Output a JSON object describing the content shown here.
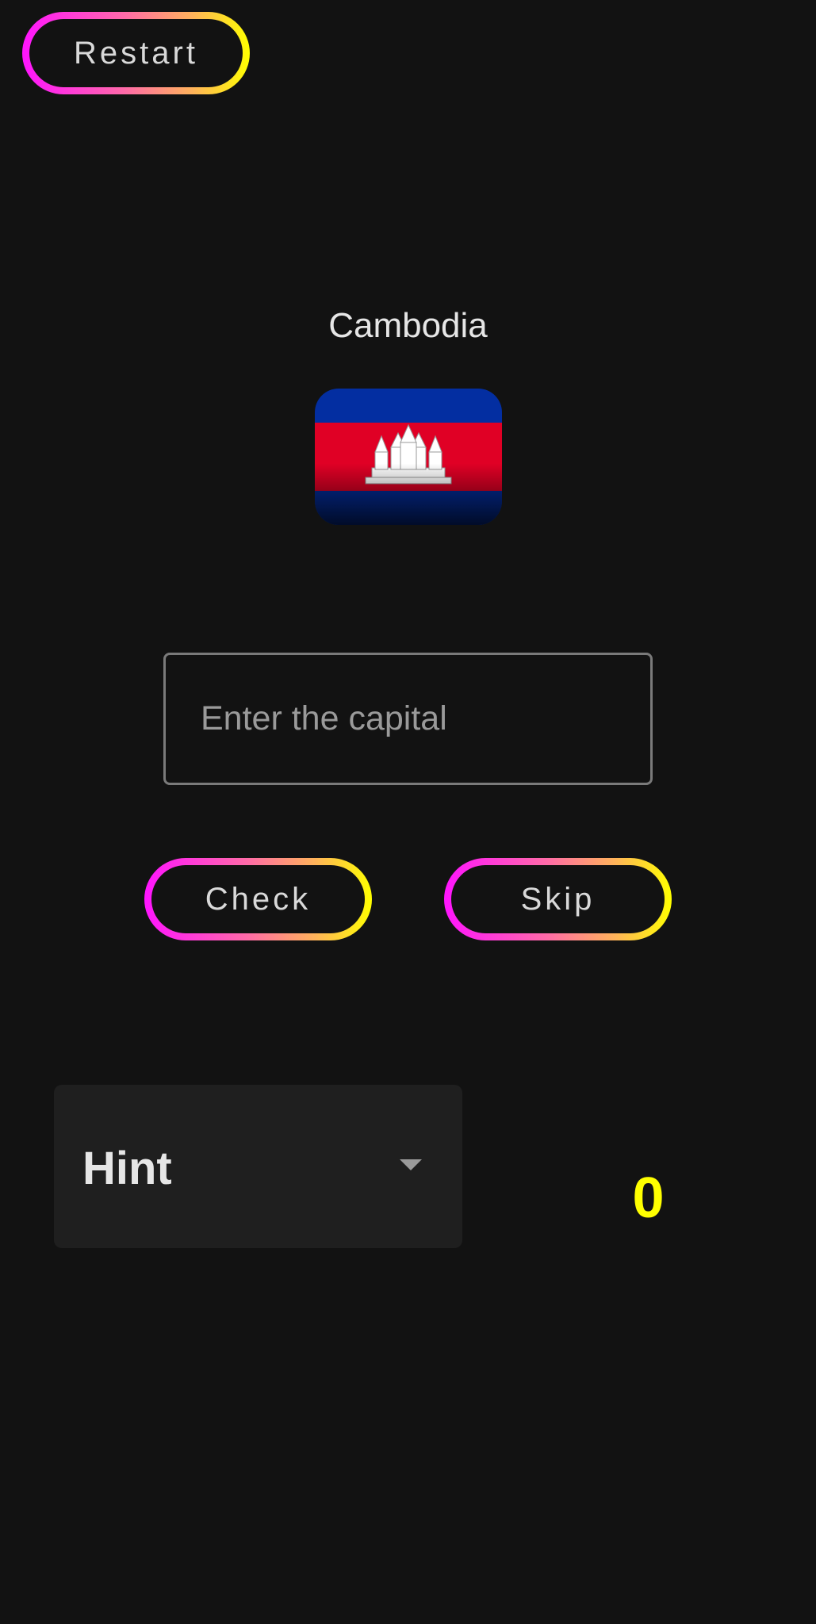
{
  "header": {
    "restart_label": "Restart"
  },
  "question": {
    "country": "Cambodia",
    "flag_icon": "cambodia-flag"
  },
  "answer": {
    "placeholder": "Enter the capital",
    "value": ""
  },
  "actions": {
    "check_label": "Check",
    "skip_label": "Skip"
  },
  "hint": {
    "label": "Hint",
    "icon": "chevron-down-icon"
  },
  "score": {
    "value": "0"
  },
  "colors": {
    "background": "#121212",
    "button_gradient_start": "#ff14ff",
    "button_gradient_end": "#ffff00",
    "score_color": "#ffff00",
    "flag_blue": "#032ea1",
    "flag_red": "#e00025"
  }
}
